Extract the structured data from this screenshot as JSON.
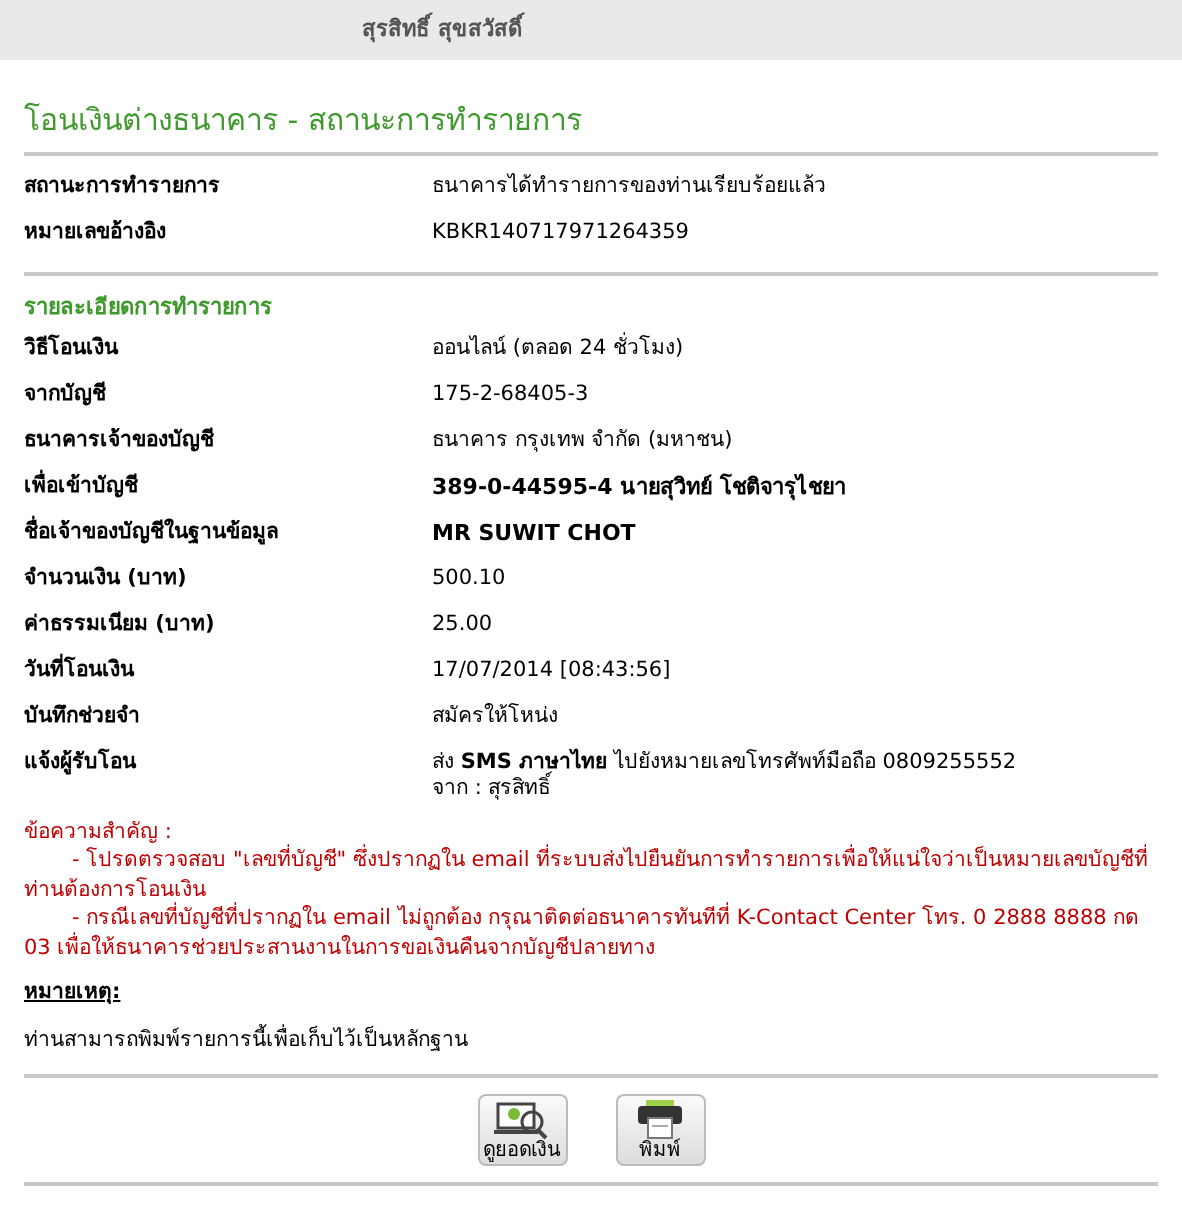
{
  "header": {
    "user_name": "สุรสิทธิ์ สุขสวัสดิ์"
  },
  "title": "โอนเงินต่างธนาคาร - สถานะการทำรายการ",
  "summary": [
    {
      "label": "สถานะการทำรายการ",
      "value": "ธนาคารได้ทำรายการของท่านเรียบร้อยแล้ว",
      "bold": false
    },
    {
      "label": "หมายเลขอ้างอิง",
      "value": "KBKR140717971264359",
      "bold": false
    }
  ],
  "details": {
    "heading": "รายละเอียดการทำรายการ",
    "rows": [
      {
        "label": "วิธีโอนเงิน",
        "value": "ออนไลน์ (ตลอด 24 ชั่วโมง)",
        "bold": false
      },
      {
        "label": "จากบัญชี",
        "value": "175-2-68405-3",
        "bold": false
      },
      {
        "label": "ธนาคารเจ้าของบัญชี",
        "value": "ธนาคาร กรุงเทพ จำกัด (มหาชน)",
        "bold": false
      },
      {
        "label": "เพื่อเข้าบัญชี",
        "value": "389-0-44595-4 นายสุวิทย์ โชติจารุไชยา",
        "bold": true
      },
      {
        "label": "ชื่อเจ้าของบัญชีในฐานข้อมูล",
        "value": "MR SUWIT CHOT",
        "bold": true
      },
      {
        "label": "จำนวนเงิน (บาท)",
        "value": "500.10",
        "bold": false
      },
      {
        "label": "ค่าธรรมเนียม (บาท)",
        "value": "25.00",
        "bold": false
      },
      {
        "label": "วันที่โอนเงิน",
        "value": "17/07/2014 [08:43:56]",
        "bold": false
      },
      {
        "label": "บันทึกช่วยจำ",
        "value": "สมัครให้โหน่ง",
        "bold": false
      },
      {
        "label": "แจ้งผู้รับโอน",
        "value": "ส่ง **SMS ภาษาไทย** ไปยังหมายเลขโทรศัพท์มือถือ 0809255552",
        "value_line_2": "จาก : สุรสิทธิ์",
        "bold": false
      }
    ]
  },
  "important": {
    "heading": "ข้อความสำคัญ :",
    "items": [
      "- โปรดตรวจสอบ \"เลขที่บัญชี\" ซึ่งปรากฏใน email ที่ระบบส่งไปยืนยันการทำรายการเพื่อให้แน่ใจว่าเป็นหมายเลขบัญชีที่ท่านต้องการโอนเงิน",
      "- กรณีเลขที่บัญชีที่ปรากฏใน email ไม่ถูกต้อง กรุณาติดต่อธนาคารทันทีที่ K-Contact Center โทร. 0 2888 8888 กด 03 เพื่อให้ธนาคารช่วยประสานงานในการขอเงินคืนจากบัญชีปลายทาง"
    ]
  },
  "note": {
    "heading": "หมายเหตุ:",
    "text": "ท่านสามารถพิมพ์รายการนี้เพื่อเก็บไว้เป็นหลักฐาน"
  },
  "buttons": [
    {
      "kind": "balance",
      "label": "ดูยอดเงิน"
    },
    {
      "kind": "print",
      "label": "พิมพ์"
    }
  ]
}
